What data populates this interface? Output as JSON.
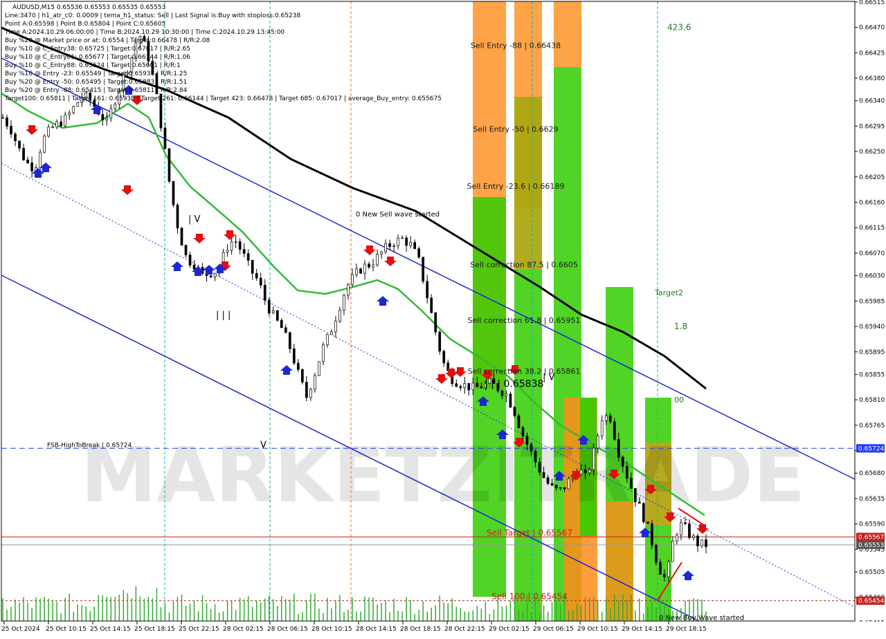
{
  "info_lines": [
    "AUDUSD,M15  0.65536 0.65553 0.65535 0.65553",
    "Line:3470  |  h1_atr_c0: 0.0009  |  tema_h1_status: Sell  |  Last Signal is:Buy with stoploss:0.65238",
    "Point A:0.65598  |  Point B:0.65804  |  Point C:0.65605",
    "Time A:2024.10.29 06:00:00  |  Time B:2024.10.29 10:30:00  |  Time C:2024.10.29 13:45:00",
    "Buy %20 @ Market price or at: 0.6554  |  Target:0.66478  |  R/R:2.08",
    "Buy %10 @ C_Entry38: 0.65725  |  Target:0.67017  |  R/R:2.65",
    "Buy %10 @ C_Entry61: 0.65677  |  Target:0.66144  |  R/R:1.06",
    "Buy %10 @ C_Entry88: 0.65624  |  Target:0.65601  |  R/R:1",
    "Buy %10 @ Entry -23: 0.65549  |  Target:0.65938  |  R/R:1.25",
    "Buy %20 @ Entry -50: 0.65495  |  Target:0.65883  |  R/R:1.51",
    "Buy %20 @ Entry -88: 0.65415  |  Target:0.65811  |  R/R:2.84",
    "Target100: 0.65811  |  Target 161: 0.65938  |  Target 261: 0.66144  |  Target 423: 0.66478  |  Target 685: 0.67017  |  average_Buy_entry: 0.655675"
  ],
  "watermark": "MARKETZIТRADE",
  "chart_data": {
    "type": "candlestick",
    "symbol": "AUDUSD",
    "timeframe": "M15",
    "ylim": [
      0.65418,
      0.66516
    ],
    "y_ticks": [
      "0.66515",
      "0.66470",
      "0.66425",
      "0.66380",
      "0.66340",
      "0.66295",
      "0.66250",
      "0.66205",
      "0.66160",
      "0.66115",
      "0.66070",
      "0.66030",
      "0.65985",
      "0.65940",
      "0.65895",
      "0.65855",
      "0.65810",
      "0.65765",
      "0.65720",
      "0.65680",
      "0.65635",
      "0.65590",
      "0.65545",
      "0.65505",
      "0.65460",
      "0.65415"
    ],
    "x_ticks": [
      "25 Oct 2024",
      "25 Oct 10:15",
      "25 Oct 14:15",
      "25 Oct 18:15",
      "25 Oct 22:15",
      "28 Oct 02:15",
      "28 Oct 06:15",
      "28 Oct 10:15",
      "28 Oct 14:15",
      "28 Oct 18:15",
      "28 Oct 22:15",
      "29 Oct 02:15",
      "29 Oct 06:15",
      "29 Oct 10:15",
      "29 Oct 14:15",
      "29 Oct 18:15"
    ],
    "close_path": [
      0.6631,
      0.6629,
      0.66255,
      0.6623,
      0.6622,
      0.6627,
      0.6629,
      0.663,
      0.6631,
      0.6633,
      0.6635,
      0.6634,
      0.6632,
      0.663,
      0.6634,
      0.6638,
      0.6641,
      0.6646,
      0.6643,
      0.6637,
      0.6628,
      0.6618,
      0.6611,
      0.6606,
      0.6605,
      0.6603,
      0.66035,
      0.6604,
      0.6608,
      0.66095,
      0.6607,
      0.6604,
      0.6602,
      0.6598,
      0.65955,
      0.65935,
      0.659,
      0.65855,
      0.65815,
      0.65855,
      0.659,
      0.6593,
      0.6597,
      0.6601,
      0.6603,
      0.66045,
      0.6605,
      0.66065,
      0.6608,
      0.6609,
      0.66095,
      0.66085,
      0.6606,
      0.66,
      0.6594,
      0.6588,
      0.6585,
      0.6584,
      0.65835,
      0.6583,
      0.65835,
      0.6584,
      0.6583,
      0.6582,
      0.6579,
      0.6575,
      0.6572,
      0.6569,
      0.65665,
      0.6565,
      0.6565,
      0.6567,
      0.6569,
      0.6567,
      0.6572,
      0.6578,
      0.6578,
      0.6572,
      0.6568,
      0.6564,
      0.6561,
      0.6557,
      0.65515,
      0.6549,
      0.6557,
      0.6559,
      0.6557,
      0.65555,
      0.65553
    ],
    "current_price": "0.65553",
    "price_tags": [
      {
        "value": "0.65724",
        "color": "#1e3cff"
      },
      {
        "value": "0.65567",
        "color": "#c81e1e"
      },
      {
        "value": "0.65553",
        "color": "#555555"
      },
      {
        "value": "0.65454",
        "color": "#c81e1e"
      }
    ],
    "horizontal_lines": [
      {
        "name": "FSB-HighToBreak",
        "label": "FSB-HighToBreak  |  0.65724",
        "value": 0.65724,
        "color": "#1e3cff",
        "style": "dashed"
      },
      {
        "name": "sell-target",
        "label": "Sell Target | 0.65567",
        "value": 0.65567,
        "color": "#c81e1e",
        "style": "solid"
      },
      {
        "name": "sell-100",
        "label": "Sell 100 | 0.65454",
        "value": 0.65454,
        "color": "#c81e1e",
        "style": "dotted"
      }
    ],
    "sell_levels": [
      {
        "label": "Sell Entry -88 | 0.66438",
        "value": 0.66438
      },
      {
        "label": "Sell Entry -50 | 0.6629",
        "value": 0.6629
      },
      {
        "label": "Sell Entry -23.6 | 0.66189",
        "value": 0.66189
      },
      {
        "label": "Sell correction 87.5 | 0.6605",
        "value": 0.6605
      },
      {
        "label": "Sell correction 61.8 | 0.65951",
        "value": 0.65951
      },
      {
        "label": "Sell correction 38.2 | 0.65861",
        "value": 0.65861
      }
    ],
    "annotations": [
      {
        "text": "0 New Sell wave started",
        "x": "28 Oct 10:15",
        "y": 0.6614
      },
      {
        "text": "0 New Buy Wave started",
        "x": "29 Oct 14:15",
        "y": 0.65425
      },
      {
        "text": "| | | 0.65838",
        "x": "28 Oct 22:15",
        "y": 0.65838
      },
      {
        "text": "423.6",
        "x": "29 Oct 10:15",
        "y": 0.6647
      },
      {
        "text": "Target2",
        "x": "29 Oct 14:15",
        "y": 0.66
      },
      {
        "text": "1.8",
        "x": "29 Oct 14:15",
        "y": 0.6594
      },
      {
        "text": "00",
        "x": "29 Oct 14:15",
        "y": 0.6581
      },
      {
        "text": "| | |",
        "x": "25 Oct 22:15",
        "y": 0.6596
      },
      {
        "text": "| V",
        "x": "25 Oct 22:15",
        "y": 0.6613
      },
      {
        "text": "V",
        "x": "28 Oct 02:15",
        "y": 0.6573
      },
      {
        "text": "| V",
        "x": "29 Oct 06:15",
        "y": 0.6585
      }
    ]
  }
}
